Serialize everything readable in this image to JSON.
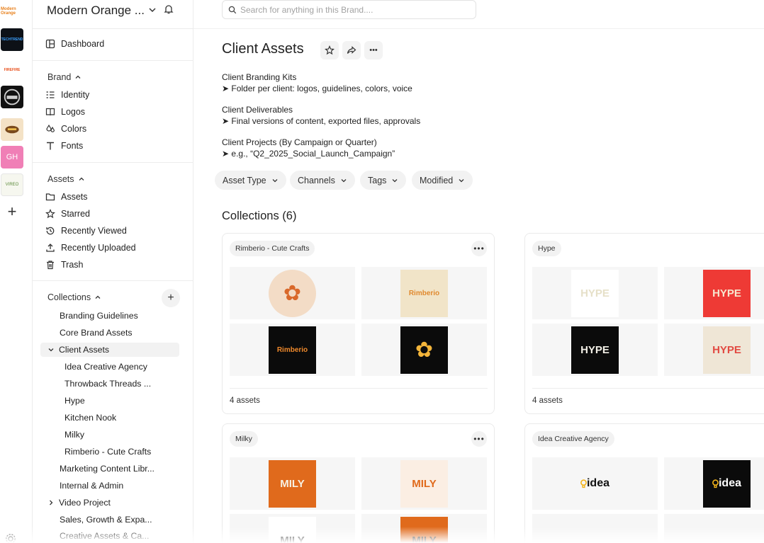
{
  "brand_rail": {
    "tiles": [
      {
        "id": "modern-orange",
        "label": "Modern Orange",
        "bg": "#ffffff",
        "fg": "#e8801c"
      },
      {
        "id": "tech-brand",
        "label": "TECHTREND",
        "bg": "#0d1117",
        "fg": "#3aa0ff"
      },
      {
        "id": "firefire",
        "label": "FIREFIRE",
        "bg": "#ffffff",
        "fg": "#e8501c"
      },
      {
        "id": "badge-brand",
        "label": "",
        "bg": "#111111",
        "fg": "#d8d8d8"
      },
      {
        "id": "craft-brand",
        "label": "",
        "bg": "#f4e2c6",
        "fg": "#7a4a1e"
      },
      {
        "id": "gh",
        "label": "GH",
        "bg": "#f07fb6",
        "fg": "#ffffff"
      },
      {
        "id": "vireo",
        "label": "VIREO",
        "bg": "#f6f7ef",
        "fg": "#5a8a3a"
      }
    ],
    "add_label": "+"
  },
  "sidebar": {
    "brand_name": "Modern Orange ...",
    "dashboard": "Dashboard",
    "brand_section": "Brand",
    "brand_items": [
      "Identity",
      "Logos",
      "Colors",
      "Fonts"
    ],
    "assets_section": "Assets",
    "assets_items": [
      "Assets",
      "Starred",
      "Recently Viewed",
      "Recently Uploaded",
      "Trash"
    ],
    "collections_section": "Collections",
    "collections": {
      "branding_guidelines": "Branding Guidelines",
      "core_brand_assets": "Core Brand Assets",
      "client_assets": "Client Assets",
      "children": [
        "Idea Creative Agency",
        "Throwback Threads ...",
        "Hype",
        "Kitchen Nook",
        "Milky",
        "Rimberio - Cute Crafts"
      ],
      "marketing": "Marketing Content Libr...",
      "internal": "Internal & Admin",
      "video": "Video Project",
      "sales": "Sales, Growth & Expa...",
      "creative": "Creative Assets & Ca..."
    }
  },
  "search": {
    "placeholder": "Search for anything in this Brand...."
  },
  "main": {
    "title": "Client Assets",
    "description": [
      {
        "heading": "Client Branding Kits",
        "detail": "➤ Folder per client: logos, guidelines, colors, voice"
      },
      {
        "heading": "Client Deliverables",
        "detail": "➤ Final versions of content, exported files, approvals"
      },
      {
        "heading": "Client Projects (By Campaign or Quarter)",
        "detail": "➤ e.g., “Q2_2025_Social_Launch_Campaign”"
      }
    ],
    "filters": [
      "Asset Type",
      "Channels",
      "Tags",
      "Modified"
    ],
    "collections_heading": "Collections (6)",
    "cards": [
      {
        "name": "Rimberio - Cute Crafts",
        "count": "4 assets",
        "thumbs": [
          {
            "text": "✿",
            "bg": "#f3dcc6",
            "fg": "#d9682a"
          },
          {
            "text": "Rimberio",
            "bg": "#f1e4c8",
            "fg": "#e0892e"
          },
          {
            "text": "Rimberio",
            "bg": "#0b0b0b",
            "fg": "#f08a2c"
          },
          {
            "text": "✿",
            "bg": "#0b0b0b",
            "fg": "#f2b43a"
          }
        ]
      },
      {
        "name": "Hype",
        "count": "4 assets",
        "thumbs": [
          {
            "text": "HYPE",
            "bg": "#ffffff",
            "fg": "#e6e0c8"
          },
          {
            "text": "HYPE",
            "bg": "#ee3a35",
            "fg": "#f6e7cf"
          },
          {
            "text": "HYPE",
            "bg": "#0b0b0b",
            "fg": "#f2efe6"
          },
          {
            "text": "HYPE",
            "bg": "#efe6d6",
            "fg": "#e24a42"
          }
        ]
      },
      {
        "name": "Milky",
        "count": "",
        "thumbs": [
          {
            "text": "MILY",
            "bg": "#e06a1c",
            "fg": "#f7f1e3"
          },
          {
            "text": "MILY",
            "bg": "#fbeee3",
            "fg": "#e06a1c"
          },
          {
            "text": "MILY",
            "bg": "#ffffff",
            "fg": "#111111"
          },
          {
            "text": "MILY",
            "bg": "#e06a1c",
            "fg": "#111111"
          }
        ]
      },
      {
        "name": "Idea Creative Agency",
        "count": "",
        "thumbs": [
          {
            "text": "idea",
            "bg": "#f6f6f6",
            "fg": "#111111"
          },
          {
            "text": "idea",
            "bg": "#0b0b0b",
            "fg": "#ffffff"
          },
          {
            "text": "",
            "bg": "#f6f6f6",
            "fg": "#111111"
          },
          {
            "text": "",
            "bg": "#f6f6f6",
            "fg": "#111111"
          }
        ]
      }
    ],
    "more_label": "•••"
  }
}
